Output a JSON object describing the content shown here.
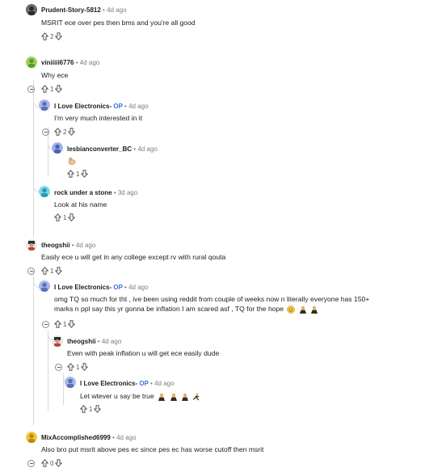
{
  "comments": [
    {
      "user": "Prudent-Story-5812",
      "time": "4d ago",
      "text": "MSRIT ece over pes then bms and you're all good",
      "votes": "2"
    },
    {
      "user": "viniiiii6776",
      "time": "4d ago",
      "text": "Why ece",
      "votes": "1"
    },
    {
      "user": "I Love Electronics-",
      "op": "OP",
      "time": "4d ago",
      "text": "I'm very much interested in it",
      "votes": "2"
    },
    {
      "user": "lesbianconverter_BC",
      "time": "4d ago",
      "text": "",
      "votes": "1"
    },
    {
      "user": "rock under a stone",
      "time": "3d ago",
      "text": "Look at his name",
      "votes": "1"
    },
    {
      "user": "theogshii",
      "time": "4d ago",
      "text": "Easily ece u will get in any college except rv with rural qouta",
      "votes": "1"
    },
    {
      "user": "I Love Electronics-",
      "op": "OP",
      "time": "4d ago",
      "text_line1": "omg TQ so much for tht , ive been using reddit from couple of weeks now n literally everyone has 150+",
      "text_line2": "marks n ppl say this yr gonna be inflation I am scared asf , TQ for the hope",
      "votes": "1"
    },
    {
      "user": "theogshii",
      "time": "4d ago",
      "text": "Even with peak inflation u will get ece easily dude",
      "votes": "1"
    },
    {
      "user": "I Love Electronics-",
      "op": "OP",
      "time": "4d ago",
      "text": "Let wtever u say be true",
      "votes": "1"
    },
    {
      "user": "MixAccomplished6999",
      "time": "4d ago",
      "text": "Also bro put msrit above pes ec since pes ec has worse cutoff then msrit",
      "votes": "0"
    }
  ],
  "separator": "•",
  "icons": {
    "upvote": "upvote-arrow-icon",
    "downvote": "downvote-arrow-icon",
    "collapse": "collapse-thread-icon"
  }
}
